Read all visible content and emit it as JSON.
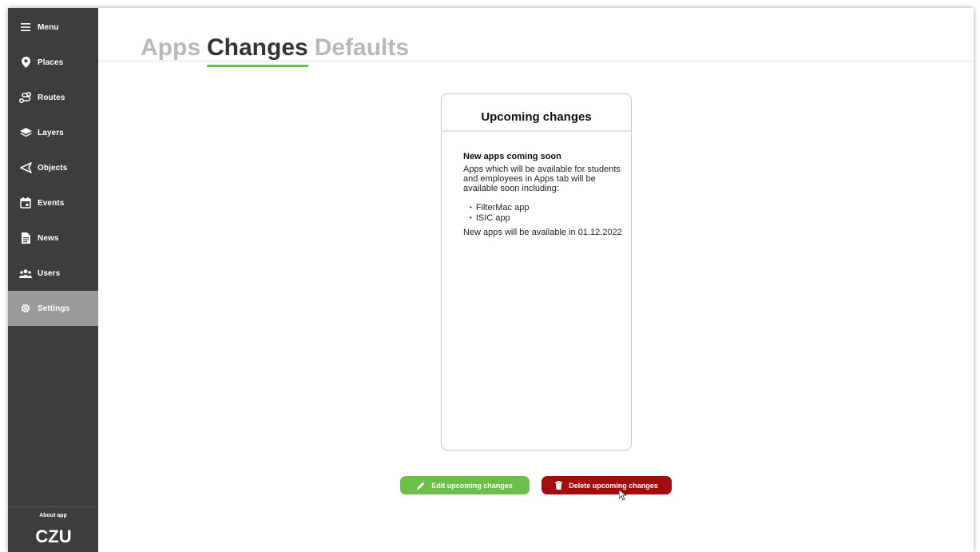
{
  "sidebar": {
    "items": [
      {
        "label": "Menu",
        "icon": "hamburger-icon"
      },
      {
        "label": "Places",
        "icon": "map-pin-icon"
      },
      {
        "label": "Routes",
        "icon": "route-icon"
      },
      {
        "label": "Layers",
        "icon": "layers-icon"
      },
      {
        "label": "Objects",
        "icon": "send-icon"
      },
      {
        "label": "Events",
        "icon": "calendar-icon"
      },
      {
        "label": "News",
        "icon": "document-icon"
      },
      {
        "label": "Users",
        "icon": "users-icon"
      },
      {
        "label": "Settings",
        "icon": "gear-icon",
        "active": true
      }
    ],
    "about_label": "About app",
    "logo_text": "CZU"
  },
  "tabs": [
    {
      "label": "Apps",
      "active": false
    },
    {
      "label": "Changes",
      "active": true
    },
    {
      "label": "Defaults",
      "active": false
    }
  ],
  "card": {
    "title": "Upcoming changes",
    "heading": "New apps coming soon",
    "intro": "Apps which will be available for students and employees in Apps tab will be available soon including:",
    "list": [
      "FilterMac app",
      "ISIC app"
    ],
    "footer": "New apps will be available in 01.12.2022"
  },
  "actions": {
    "edit_label": "Edit upcoming changes",
    "delete_label": "Delete upcoming changes"
  },
  "colors": {
    "sidebar_bg": "#3d3d3d",
    "active_item_bg": "#9b9b9b",
    "accent_green": "#6dbf4b",
    "danger_red": "#a30d0d"
  }
}
